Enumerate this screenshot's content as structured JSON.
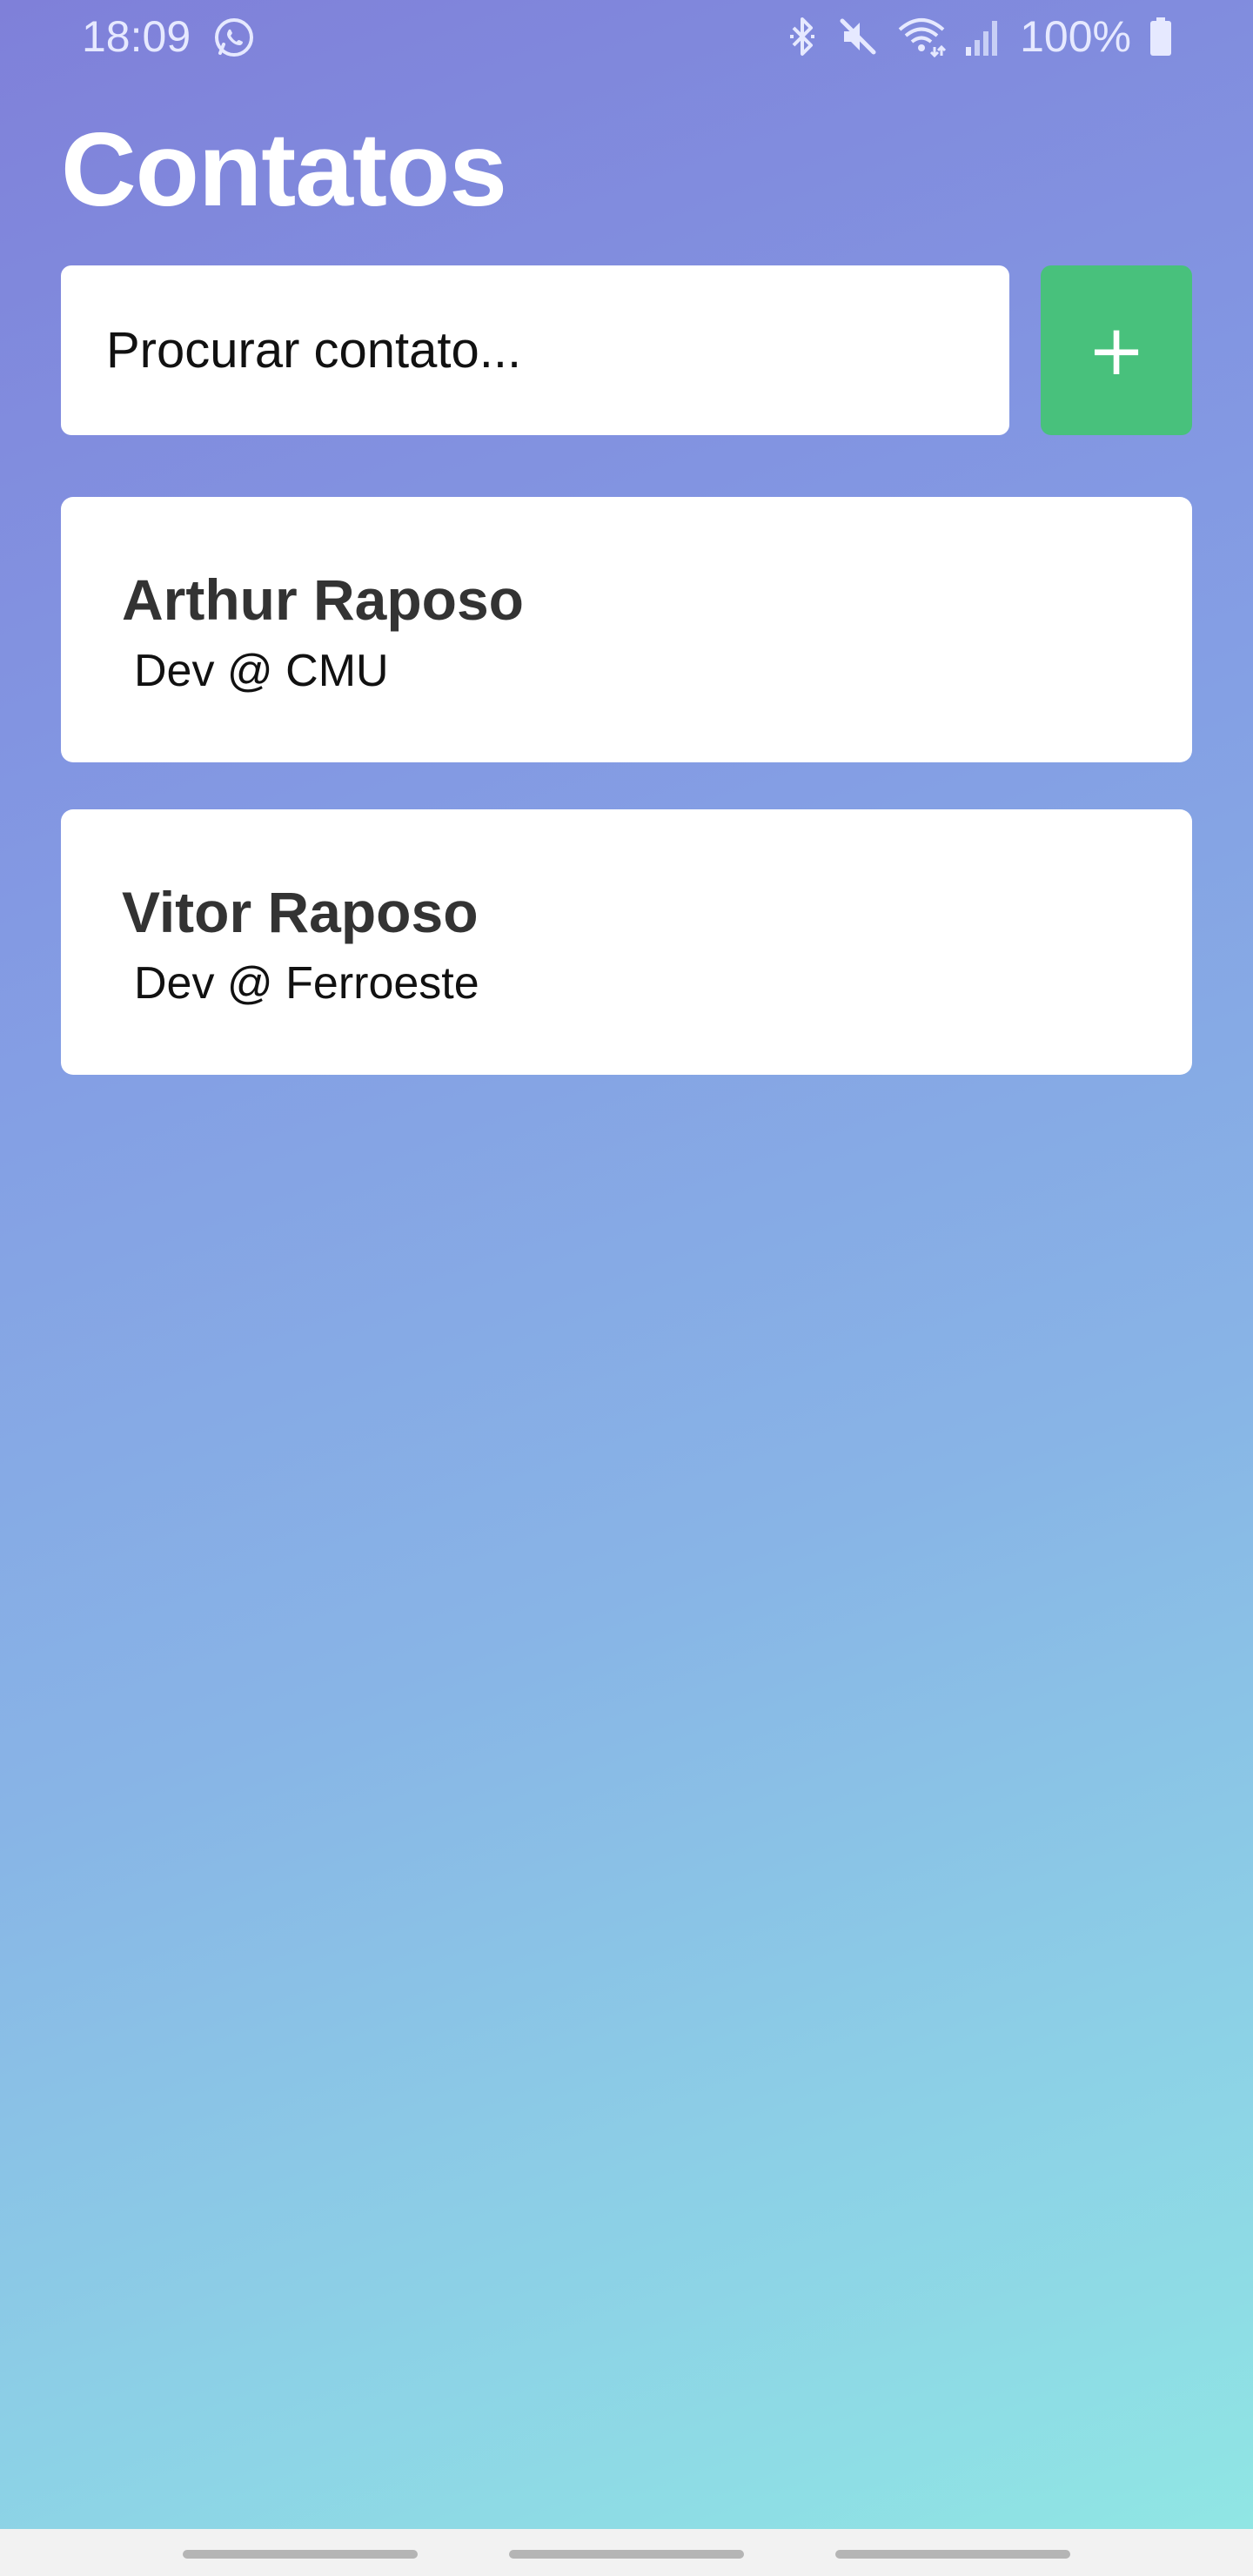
{
  "status_bar": {
    "time": "18:09",
    "battery": "100%",
    "icons": [
      "whatsapp-icon",
      "bluetooth-icon",
      "mute-icon",
      "wifi-icon",
      "signal-icon",
      "battery-icon"
    ]
  },
  "header": {
    "title": "Contatos"
  },
  "search": {
    "placeholder": "Procurar contato..."
  },
  "add_button": {
    "label": "+",
    "color": "#48c17c"
  },
  "contacts": [
    {
      "name": "Arthur Raposo",
      "role": "Dev @ CMU"
    },
    {
      "name": "Vitor Raposo",
      "role": "Dev @ Ferroeste"
    }
  ],
  "colors": {
    "gradient_top": "#7f80d9",
    "gradient_bottom": "#90e8e4",
    "card": "#ffffff",
    "title": "#ffffff"
  }
}
